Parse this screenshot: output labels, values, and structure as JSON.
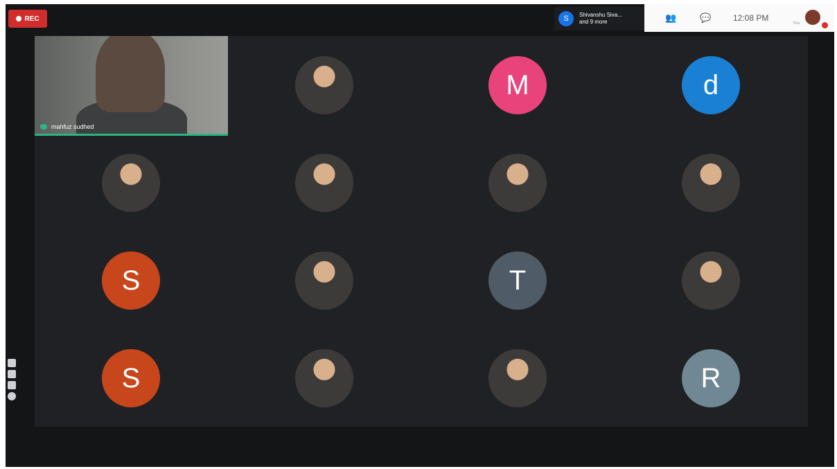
{
  "recording": {
    "label": "REC",
    "color": "#d22d2d"
  },
  "presenter": {
    "avatar_letter": "S",
    "line1": "Shivanshu Siva...",
    "line2": "and 9 more"
  },
  "header": {
    "time": "12:08 PM",
    "status_small": "You"
  },
  "self_view": {
    "name": "mahfuz sudhed"
  },
  "participants": [
    {
      "type": "photo",
      "color": "#b68a52",
      "icon": "profile-photo-icon"
    },
    {
      "type": "letter",
      "letter": "M",
      "color": "#e8437a"
    },
    {
      "type": "letter",
      "letter": "d",
      "color": "#1a80d4"
    },
    {
      "type": "photo",
      "color": "#dcdcdc",
      "icon": "profile-photo-icon"
    },
    {
      "type": "photo",
      "color": "#6f8bd0",
      "icon": "profile-photo-icon"
    },
    {
      "type": "photo",
      "color": "#d79a2c",
      "icon": "profile-photo-icon"
    },
    {
      "type": "photo",
      "color": "#52b534",
      "icon": "profile-photo-icon"
    },
    {
      "type": "letter",
      "letter": "S",
      "color": "#c7461b"
    },
    {
      "type": "photo",
      "color": "#8a847a",
      "icon": "profile-photo-icon"
    },
    {
      "type": "letter",
      "letter": "T",
      "color": "#4f5b66"
    },
    {
      "type": "photo",
      "color": "#e7d3c4",
      "icon": "profile-photo-icon"
    },
    {
      "type": "letter",
      "letter": "S",
      "color": "#c7461b"
    },
    {
      "type": "photo",
      "color": "#c43d3d",
      "icon": "profile-photo-icon"
    },
    {
      "type": "photo",
      "color": "#e8d7a7",
      "icon": "profile-photo-icon"
    },
    {
      "type": "letter",
      "letter": "R",
      "color": "#6f8893"
    }
  ]
}
